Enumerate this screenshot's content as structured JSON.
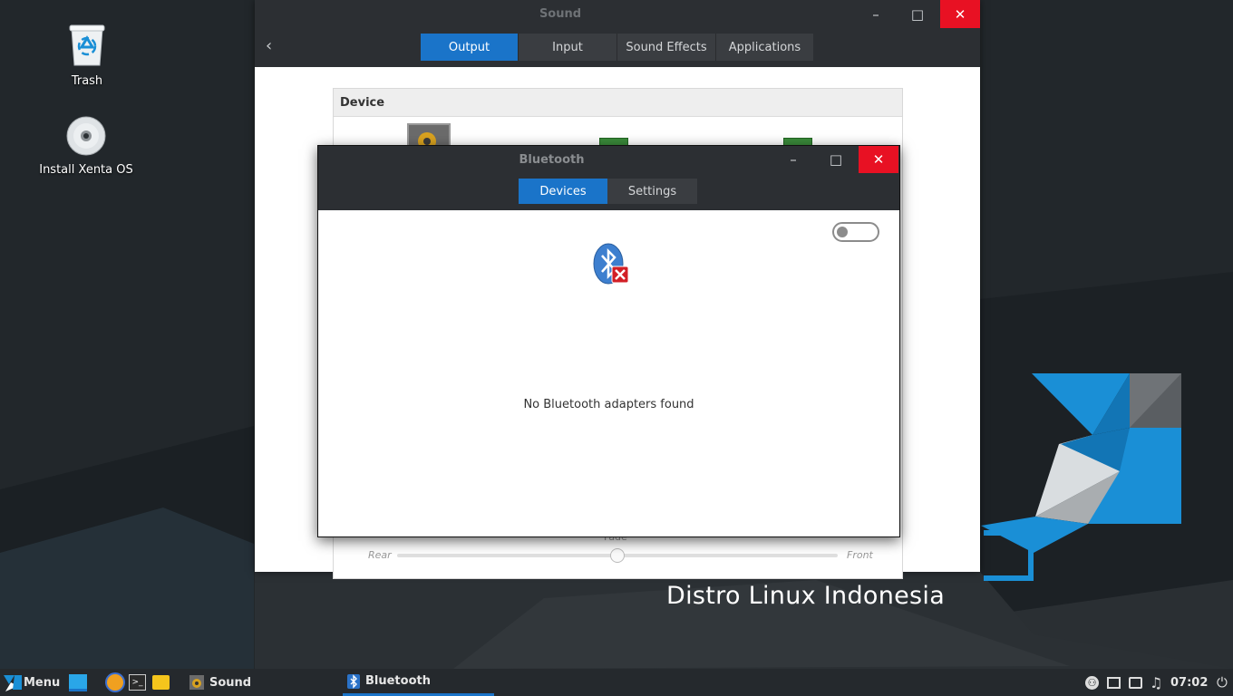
{
  "desktop": {
    "icons": [
      {
        "label": "Trash",
        "icon": "trash-icon"
      },
      {
        "label": "Install Xenta OS",
        "icon": "disc-icon"
      }
    ],
    "wallpaper_tagline": "Distro Linux Indonesia"
  },
  "sound_window": {
    "title": "Sound",
    "tabs": [
      "Output",
      "Input",
      "Sound Effects",
      "Applications"
    ],
    "active_tab": "Output",
    "device_header": "Device",
    "fade": {
      "label": "Fade",
      "left": "Rear",
      "right": "Front",
      "value": 0.5
    }
  },
  "bluetooth_window": {
    "title": "Bluetooth",
    "tabs": [
      "Devices",
      "Settings"
    ],
    "active_tab": "Devices",
    "toggle_on": false,
    "message": "No Bluetooth adapters found"
  },
  "taskbar": {
    "menu_label": "Menu",
    "tasks": [
      {
        "label": "Sound",
        "icon": "speaker-icon",
        "active": false
      },
      {
        "label": "Bluetooth",
        "icon": "bluetooth-icon",
        "active": true
      }
    ],
    "clock": "07:02"
  },
  "colors": {
    "accent": "#1a74c9",
    "close": "#e81123",
    "titlebar": "#2c2f33"
  }
}
